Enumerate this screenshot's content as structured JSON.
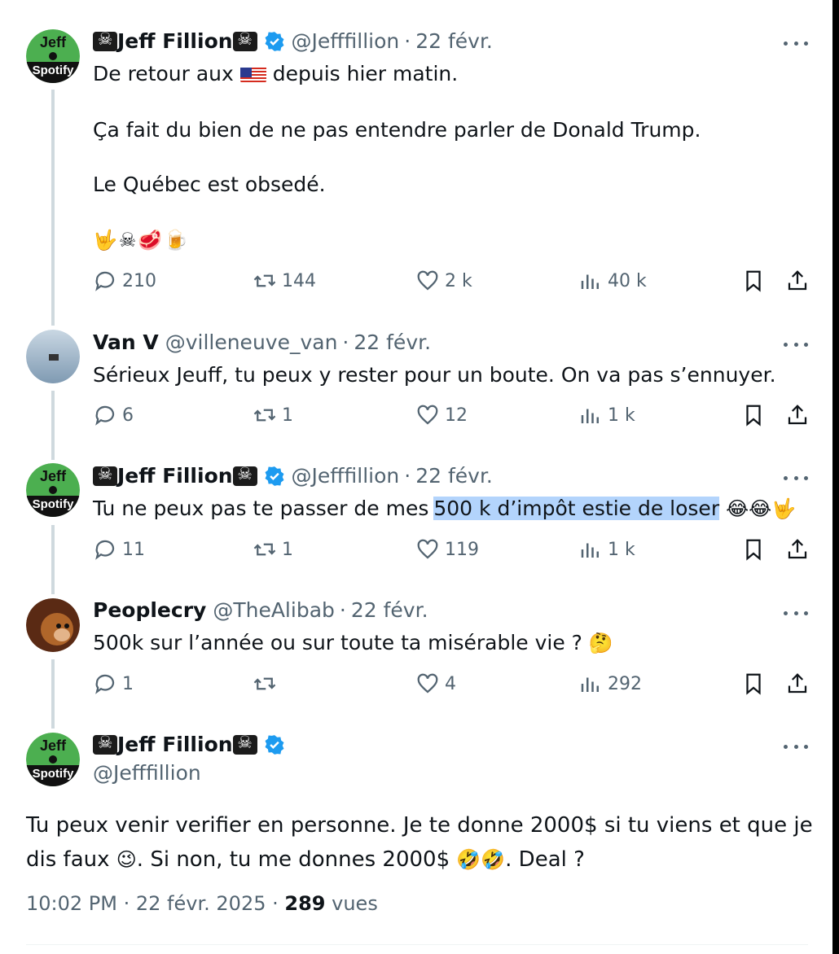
{
  "tweets": [
    {
      "name": "Jeff Fillion",
      "handle": "@Jefffillion",
      "date": "22 févr.",
      "lines": [
        "De retour aux",
        "depuis hier matin.",
        "Ça fait du bien de ne pas entendre parler de Donald Trump.",
        "Le Québec est obsedé."
      ],
      "emoji_line": "🤟☠🥩🍺",
      "replies": "210",
      "retweets": "144",
      "likes": "2 k",
      "views": "40 k"
    },
    {
      "name": "Van V",
      "handle": "@villeneuve_van",
      "date": "22 févr.",
      "lines": [
        "Sérieux Jeuff, tu peux y rester pour un boute.  On va pas s’ennuyer."
      ],
      "replies": "6",
      "retweets": "1",
      "likes": "12",
      "views": "1 k"
    },
    {
      "name": "Jeff Fillion",
      "handle": "@Jefffillion",
      "date": "22 févr.",
      "lines": [
        "Tu ne peux pas te passer de mes",
        "500 k d’impôt estie de loser",
        "😂😂🤟"
      ],
      "replies": "11",
      "retweets": "1",
      "likes": "119",
      "views": "1 k"
    },
    {
      "name": "Peoplecry",
      "handle": "@TheAlibab",
      "date": "22 févr.",
      "lines": [
        "500k sur l’année ou sur toute ta misérable vie ?",
        "🤔"
      ],
      "replies": "1",
      "retweets": "",
      "likes": "4",
      "views": "292"
    },
    {
      "name": "Jeff Fillion",
      "handle": "@Jefffillion",
      "lines": [
        "Tu peux venir verifier en personne. Je te donne 2000$ si tu viens et que je",
        "dis faux",
        "😉",
        ". Si non, tu me donnes 2000$",
        "🤣🤣",
        ". Deal ?"
      ]
    }
  ],
  "meta": {
    "time": "10:02 PM",
    "date": "22 févr. 2025",
    "views_count": "289",
    "views_label": "vues"
  },
  "avatars": {
    "jeff_top": "Jeff",
    "jeff_sub": "Spotify"
  },
  "colors": {
    "text": "#0f1419",
    "muted": "#536471",
    "verified": "#1d9bf0",
    "highlight": "#b3d4fc",
    "thread": "#cfd9de"
  }
}
